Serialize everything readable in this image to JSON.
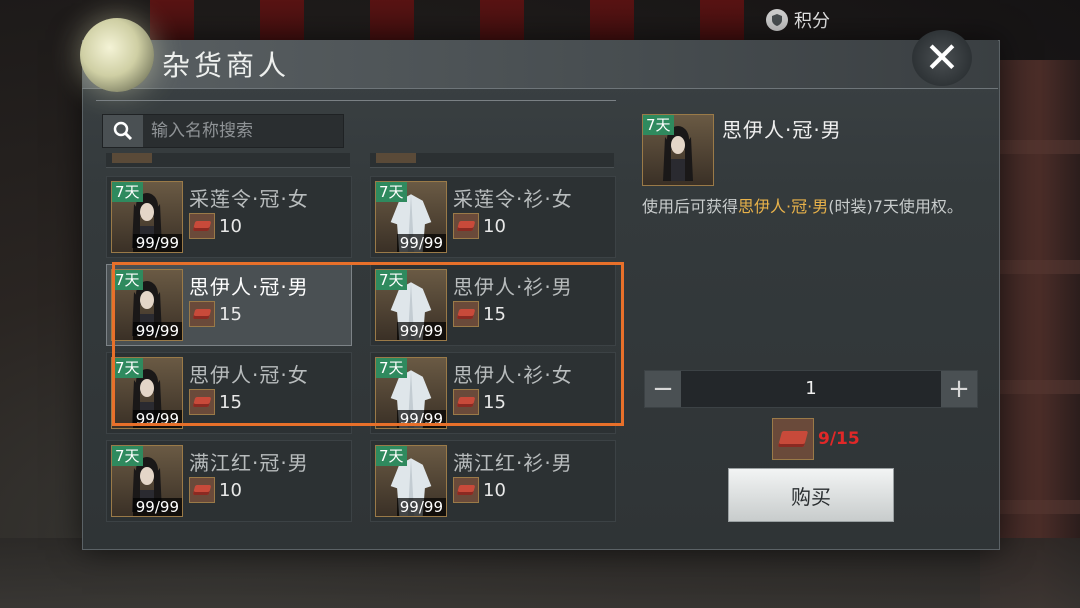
{
  "header": {
    "title": "杂货商人",
    "points_label": "积分"
  },
  "search": {
    "placeholder": "输入名称搜索"
  },
  "items": [
    {
      "name": "采莲令·冠·女",
      "days": "7天",
      "stock": "99/99",
      "price": "10",
      "selected": false
    },
    {
      "name": "采莲令·衫·女",
      "days": "7天",
      "stock": "99/99",
      "price": "10",
      "selected": false
    },
    {
      "name": "思伊人·冠·男",
      "days": "7天",
      "stock": "99/99",
      "price": "15",
      "selected": true
    },
    {
      "name": "思伊人·衫·男",
      "days": "7天",
      "stock": "99/99",
      "price": "15",
      "selected": false
    },
    {
      "name": "思伊人·冠·女",
      "days": "7天",
      "stock": "99/99",
      "price": "15",
      "selected": false
    },
    {
      "name": "思伊人·衫·女",
      "days": "7天",
      "stock": "99/99",
      "price": "15",
      "selected": false
    },
    {
      "name": "满江红·冠·男",
      "days": "7天",
      "stock": "99/99",
      "price": "10",
      "selected": false
    },
    {
      "name": "满江红·衫·男",
      "days": "7天",
      "stock": "99/99",
      "price": "10",
      "selected": false
    }
  ],
  "detail": {
    "days": "7天",
    "name": "思伊人·冠·男",
    "desc_prefix": "使用后可获得",
    "desc_highlight": "思伊人·冠·男",
    "desc_suffix": "(时装)7天使用权。",
    "quantity": "1",
    "cost": "9/15",
    "buy_label": "购买"
  },
  "colors": {
    "tag_green": "#2f8a5e",
    "highlight_orange": "#e8702a",
    "cost_red": "#e02828",
    "desc_gold": "#e8b24a"
  },
  "icons": {
    "search": "search-icon",
    "close": "close-icon",
    "currency": "chest-currency-icon",
    "points": "shield-icon"
  }
}
